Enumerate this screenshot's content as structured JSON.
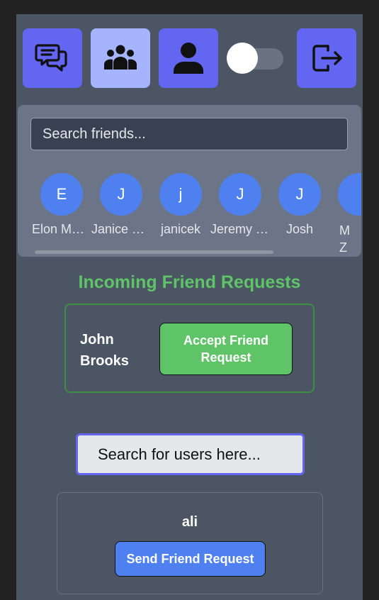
{
  "nav": {
    "buttons": [
      {
        "name": "chat",
        "icon": "chat-bubbles-icon",
        "active": false
      },
      {
        "name": "friends",
        "icon": "group-users-icon",
        "active": true
      },
      {
        "name": "profile",
        "icon": "user-icon",
        "active": false
      },
      {
        "name": "logout",
        "icon": "logout-icon",
        "active": false
      }
    ],
    "theme_toggle": {
      "on": false
    }
  },
  "friends_panel": {
    "search_placeholder": "Search friends...",
    "friends": [
      {
        "initial": "E",
        "name": "Elon Musk"
      },
      {
        "initial": "J",
        "name": "Janice Brooks"
      },
      {
        "initial": "j",
        "name": "janicek"
      },
      {
        "initial": "J",
        "name": "Jeremy Smith"
      },
      {
        "initial": "J",
        "name": "Josh"
      },
      {
        "initial": "",
        "name": "M Z"
      }
    ]
  },
  "incoming": {
    "title": "Incoming Friend Requests",
    "requests": [
      {
        "name": "John Brooks",
        "button_label": "Accept Friend Request"
      }
    ]
  },
  "user_search": {
    "placeholder": "Search for users here..."
  },
  "results": [
    {
      "name": "ali",
      "button_label": "Send Friend Request"
    }
  ],
  "colors": {
    "panel": "#4b5563",
    "nav_button": "#6366f1",
    "nav_button_active": "#a5b4fc",
    "accent_green": "#5ec467",
    "avatar_blue": "#4f80f0"
  }
}
